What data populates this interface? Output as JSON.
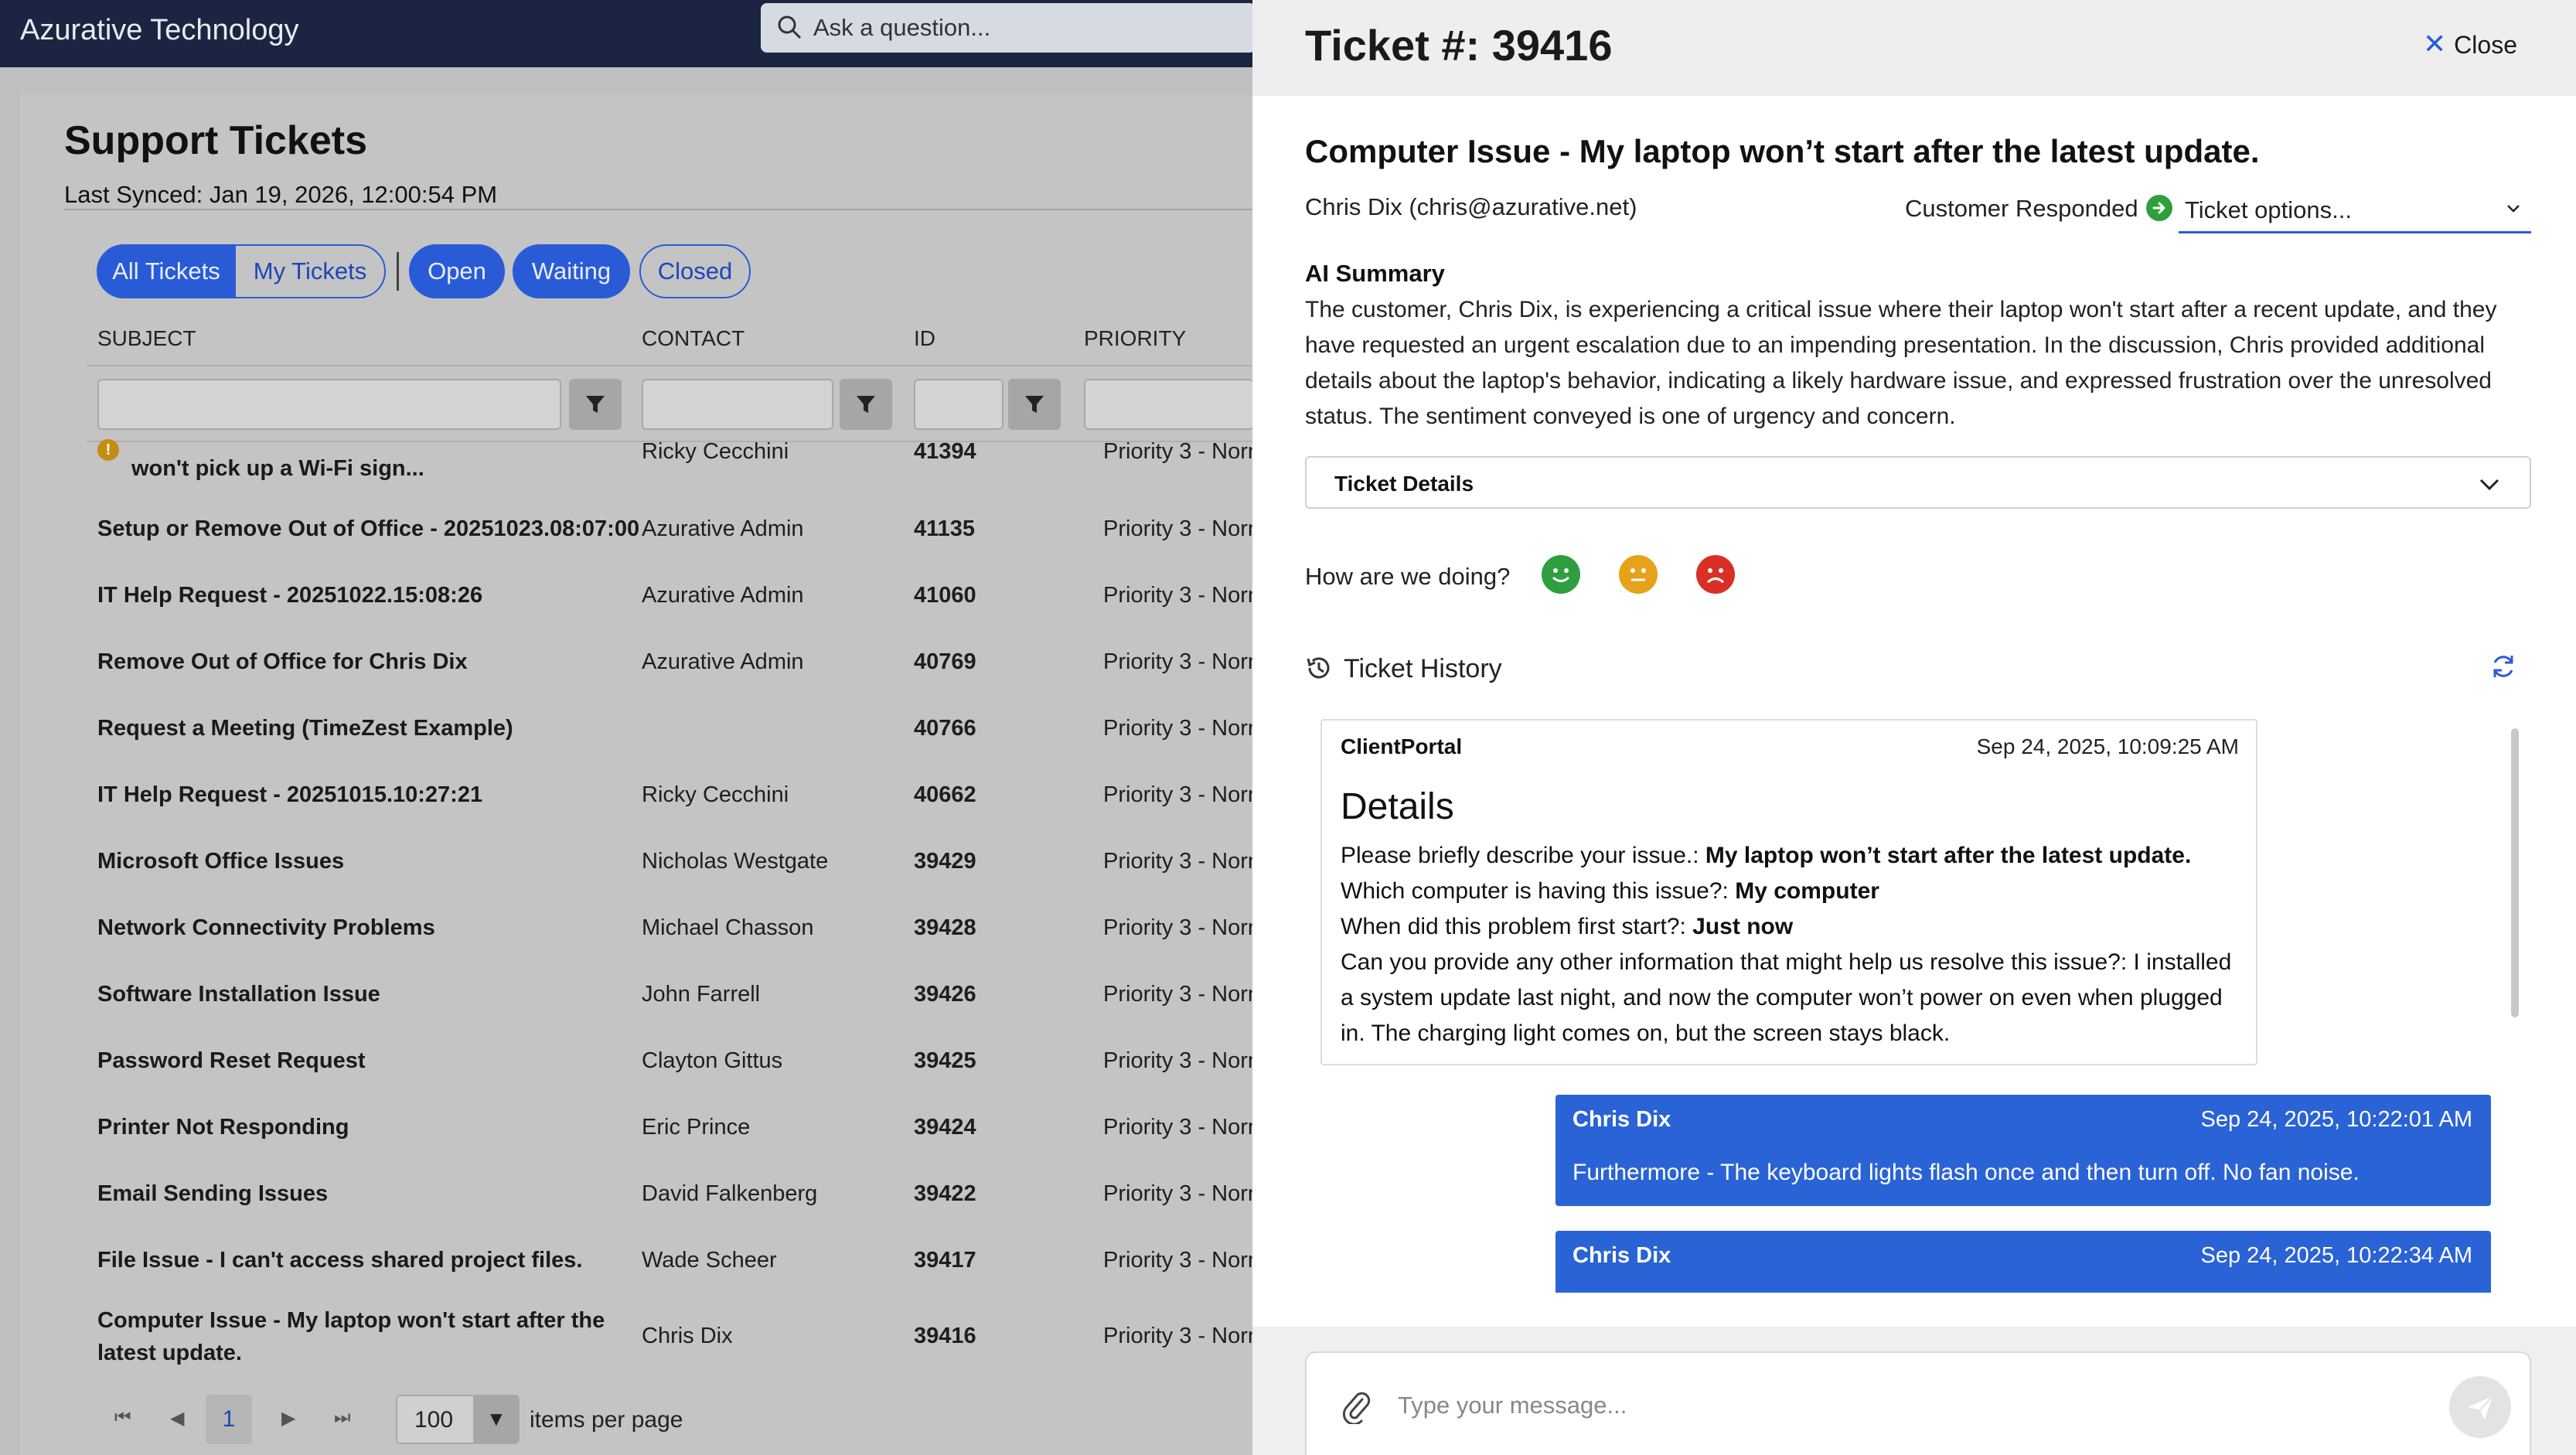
{
  "app": {
    "brand": "Azurative Technology",
    "search_placeholder": "Ask a question..."
  },
  "tickets_page": {
    "title": "Support Tickets",
    "last_synced": "Last Synced: Jan 19, 2026, 12:00:54 PM",
    "filters": [
      "All Tickets",
      "My Tickets",
      "Open",
      "Waiting",
      "Closed"
    ],
    "active_filter": "All Tickets",
    "columns": {
      "subject": "SUBJECT",
      "contact": "CONTACT",
      "id": "ID",
      "priority": "PRIORITY"
    },
    "rows": [
      {
        "subject": "won't pick up a Wi-Fi sign...",
        "contact": "Ricky Cecchini",
        "id": "41394",
        "priority": "Priority 3 - Norn",
        "flag": "!"
      },
      {
        "subject": "Setup or Remove Out of Office - 20251023.08:07:00",
        "contact": "Azurative Admin",
        "id": "41135",
        "priority": "Priority 3 - Norn"
      },
      {
        "subject": "IT Help Request - 20251022.15:08:26",
        "contact": "Azurative Admin",
        "id": "41060",
        "priority": "Priority 3 - Norn"
      },
      {
        "subject": "Remove Out of Office for Chris Dix",
        "contact": "Azurative Admin",
        "id": "40769",
        "priority": "Priority 3 - Norn"
      },
      {
        "subject": "Request a Meeting (TimeZest Example)",
        "contact": "",
        "id": "40766",
        "priority": "Priority 3 - Norn"
      },
      {
        "subject": "IT Help Request - 20251015.10:27:21",
        "contact": "Ricky Cecchini",
        "id": "40662",
        "priority": "Priority 3 - Norn"
      },
      {
        "subject": "Microsoft Office Issues",
        "contact": "Nicholas Westgate",
        "id": "39429",
        "priority": "Priority 3 - Norn"
      },
      {
        "subject": "Network Connectivity Problems",
        "contact": "Michael Chasson",
        "id": "39428",
        "priority": "Priority 3 - Norn"
      },
      {
        "subject": "Software Installation Issue",
        "contact": "John Farrell",
        "id": "39426",
        "priority": "Priority 3 - Norn"
      },
      {
        "subject": "Password Reset Request",
        "contact": "Clayton Gittus",
        "id": "39425",
        "priority": "Priority 3 - Norn"
      },
      {
        "subject": "Printer Not Responding",
        "contact": "Eric Prince",
        "id": "39424",
        "priority": "Priority 3 - Norn"
      },
      {
        "subject": "Email Sending Issues",
        "contact": "David Falkenberg",
        "id": "39422",
        "priority": "Priority 3 - Norn"
      },
      {
        "subject": "File Issue - I can't access shared project files.",
        "contact": "Wade Scheer",
        "id": "39417",
        "priority": "Priority 3 - Norn"
      },
      {
        "subject": "Computer Issue - My laptop won't start after the",
        "subject2": "latest update.",
        "contact": "Chris Dix",
        "id": "39416",
        "priority": "Priority 3 - Norn"
      }
    ],
    "pager": {
      "current_page": "1",
      "page_size": "100",
      "label": "items per page"
    }
  },
  "ticket": {
    "title": "Ticket #: 39416",
    "close_label": "Close",
    "subject": "Computer Issue - My laptop won’t start after the latest update.",
    "requester": "Chris Dix (chris@azurative.net)",
    "status": "Customer Responded",
    "options_label": "Ticket options...",
    "ai_summary_label": "AI Summary",
    "ai_summary": "The customer, Chris Dix, is experiencing a critical issue where their laptop won't start after a recent update, and they have requested an urgent escalation due to an impending presentation. In the discussion, Chris provided additional details about the laptop's behavior, indicating a likely hardware issue, and expressed frustration over the unresolved status. The sentiment conveyed is one of urgency and concern.",
    "details_label": "Ticket Details",
    "feedback_prompt": "How are we doing?",
    "history_label": "Ticket History",
    "history": [
      {
        "from": "ClientPortal",
        "time": "Sep 24, 2025, 10:09:25 AM",
        "heading": "Details",
        "q1": "Please briefly describe your issue.: ",
        "a1": "My laptop won’t start after the latest update.",
        "q2": "Which computer is having this issue?: ",
        "a2": "My computer",
        "q3": "When did this problem first start?: ",
        "a3": "Just now",
        "q4": "Can you provide any other information that might help us resolve this issue?: I installed a system update last night, and now the computer won’t power on even when plugged in. The charging light comes on, but the screen stays black."
      },
      {
        "from": "Chris Dix",
        "time": "Sep 24, 2025, 10:22:01 AM",
        "text": "Furthermore - The keyboard lights flash once and then turn off. No fan noise."
      },
      {
        "from": "Chris Dix",
        "time": "Sep 24, 2025, 10:22:34 AM",
        "text": ""
      }
    ],
    "composer_placeholder": "Type your message..."
  },
  "colors": {
    "topbar": "#1b2541",
    "accent": "#2a5bd7",
    "bubble": "#2a63d6",
    "status_green": "#2e9e3f",
    "face_good": "#2e9e3f",
    "face_neutral": "#e8a21a",
    "face_bad": "#d93025"
  },
  "icons": [
    "search-icon",
    "filter-icon",
    "warning-icon",
    "close-icon",
    "arrow-right-circle-icon",
    "chevron-down-icon",
    "smile-icon",
    "neutral-face-icon",
    "frown-icon",
    "history-icon",
    "refresh-icon",
    "paperclip-icon",
    "send-icon"
  ]
}
